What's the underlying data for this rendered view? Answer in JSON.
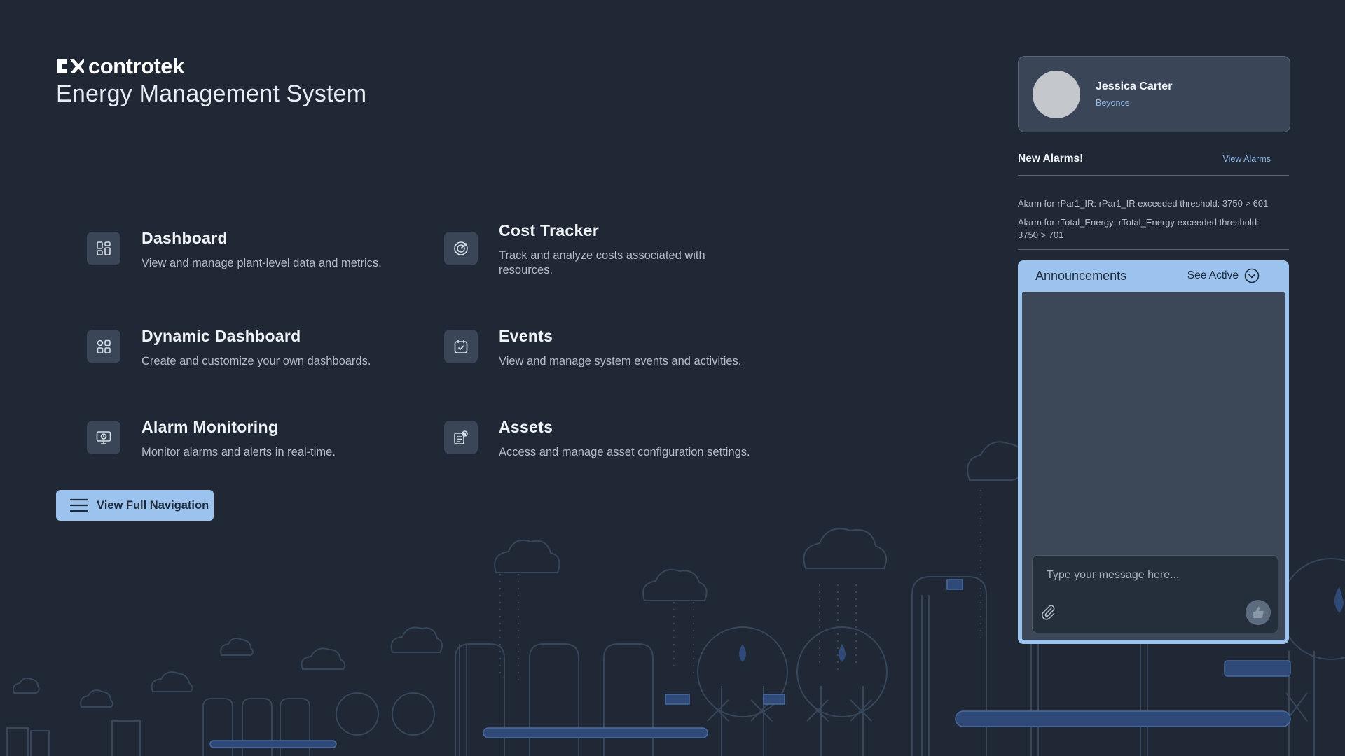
{
  "brand": {
    "logo_text": "controtek",
    "title": "Energy Management System"
  },
  "nav": {
    "items": [
      {
        "title": "Dashboard",
        "desc": "View and manage plant-level data and metrics.",
        "icon": "dashboard-icon"
      },
      {
        "title": "Cost Tracker",
        "desc": "Track and analyze costs associated with resources.",
        "icon": "cost-tracker-icon"
      },
      {
        "title": "Dynamic Dashboard",
        "desc": "Create and customize your own dashboards.",
        "icon": "dynamic-dashboard-icon"
      },
      {
        "title": "Events",
        "desc": "View and manage system events and activities.",
        "icon": "calendar-check-icon"
      },
      {
        "title": "Alarm Monitoring",
        "desc": "Monitor alarms and alerts in real-time.",
        "icon": "monitor-alarm-icon"
      },
      {
        "title": "Assets",
        "desc": "Access and manage asset configuration settings.",
        "icon": "asset-settings-icon"
      }
    ],
    "view_full_label": "View Full Navigation"
  },
  "profile": {
    "name": "Jessica Carter",
    "subtitle": "Beyonce"
  },
  "alarms": {
    "title": "New Alarms!",
    "view_label": "View Alarms",
    "items": [
      "Alarm for rPar1_IR: rPar1_IR exceeded threshold: 3750 > 601",
      "Alarm for rTotal_Energy: rTotal_Energy exceeded threshold: 3750 > 701"
    ]
  },
  "announcements": {
    "title": "Announcements",
    "see_active_label": "See Active",
    "message_placeholder": "Type your message here..."
  },
  "colors": {
    "background": "#1f2834",
    "accent": "#9bc3ee",
    "card": "#3a4557",
    "link": "#8fb6e6"
  }
}
